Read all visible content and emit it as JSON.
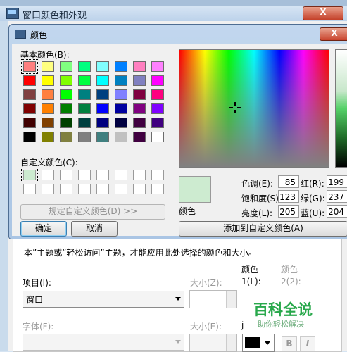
{
  "background_window": {
    "title": "窗口颜色和外观",
    "close_label": "X",
    "notice": "本”主题或“轻松访问”主题，才能应用此处选择的颜色和大小。",
    "item_label": "项目(I):",
    "item_value": "窗口",
    "size_label": "大小(Z):",
    "color1_header": "颜色",
    "color1_sub": "1(L):",
    "color2_header": "颜色",
    "color2_sub": "2(2):",
    "font_label": "字体(F):",
    "font_size_label": "大小(E):",
    "font_color_label": "j",
    "bold_label": "B",
    "italic_label": "I"
  },
  "color_dialog": {
    "title": "颜色",
    "close_label": "X",
    "basic_colors_label": "基本颜色(B):",
    "basic_colors": [
      "#ff8080",
      "#ffff80",
      "#80ff80",
      "#00ff80",
      "#80ffff",
      "#0080ff",
      "#ff80c0",
      "#ff80ff",
      "#ff0000",
      "#ffff00",
      "#80ff00",
      "#00ff40",
      "#00ffff",
      "#0080c0",
      "#8080c0",
      "#ff00ff",
      "#804040",
      "#ff8040",
      "#00ff00",
      "#008080",
      "#004080",
      "#8080ff",
      "#800040",
      "#ff0080",
      "#800000",
      "#ff8000",
      "#008000",
      "#008040",
      "#0000ff",
      "#0000a0",
      "#800080",
      "#8000ff",
      "#400000",
      "#804000",
      "#004000",
      "#004040",
      "#000080",
      "#000040",
      "#400040",
      "#400080",
      "#000000",
      "#808000",
      "#808040",
      "#808080",
      "#408080",
      "#c0c0c0",
      "#400040",
      "#ffffff"
    ],
    "selected_basic_index": 0,
    "custom_colors_label": "自定义颜色(C):",
    "custom_colors": [
      "#cdebd0",
      "#ffffff",
      "#ffffff",
      "#ffffff",
      "#ffffff",
      "#ffffff",
      "#ffffff",
      "#ffffff",
      "#ffffff",
      "#ffffff",
      "#ffffff",
      "#ffffff",
      "#ffffff",
      "#ffffff",
      "#ffffff",
      "#ffffff"
    ],
    "define_custom_label": "规定自定义颜色(D) >>",
    "ok_label": "确定",
    "cancel_label": "取消",
    "preview_label": "颜色",
    "hue_label": "色调(E):",
    "hue_value": "85",
    "sat_label": "饱和度(S):",
    "sat_value": "123",
    "lum_label": "亮度(L):",
    "lum_value": "205",
    "red_label": "红(R):",
    "red_value": "199",
    "green_label": "绿(G):",
    "green_value": "237",
    "blue_label": "蓝(U):",
    "blue_value": "204",
    "add_custom_label": "添加到自定义颜色(A)"
  },
  "watermark": {
    "text": "百科全说",
    "sub": "助你轻松解决"
  }
}
